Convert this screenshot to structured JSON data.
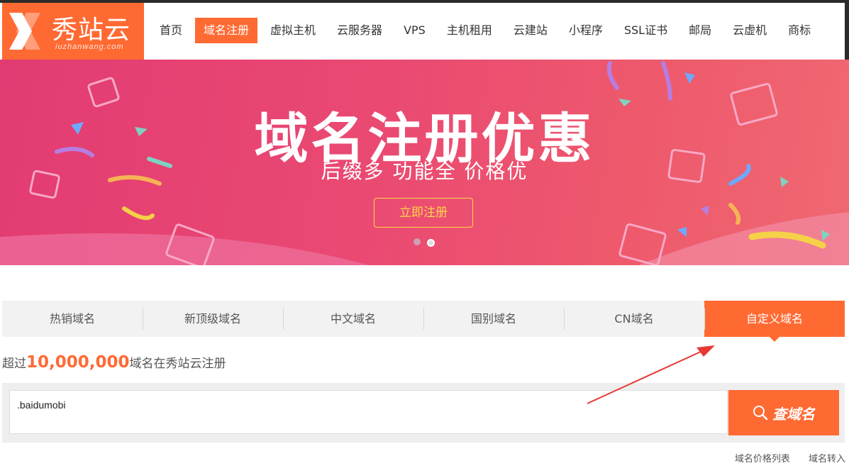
{
  "header": {
    "logo_name": "秀站云",
    "logo_sub": "iuzhanwang.com",
    "nav": [
      {
        "label": "首页",
        "active": false
      },
      {
        "label": "域名注册",
        "active": true
      },
      {
        "label": "虚拟主机",
        "active": false
      },
      {
        "label": "云服务器",
        "active": false
      },
      {
        "label": "VPS",
        "active": false
      },
      {
        "label": "主机租用",
        "active": false
      },
      {
        "label": "云建站",
        "active": false
      },
      {
        "label": "小程序",
        "active": false
      },
      {
        "label": "SSL证书",
        "active": false
      },
      {
        "label": "邮局",
        "active": false
      },
      {
        "label": "云虚机",
        "active": false
      },
      {
        "label": "商标",
        "active": false
      }
    ]
  },
  "banner": {
    "title": "域名注册优惠",
    "subtitle": "后缀多  功能全  价格优",
    "button": "立即注册",
    "slides": 2,
    "current_slide": 2
  },
  "tabs": [
    {
      "label": "热销域名",
      "active": false
    },
    {
      "label": "新顶级域名",
      "active": false
    },
    {
      "label": "中文域名",
      "active": false
    },
    {
      "label": "国别域名",
      "active": false
    },
    {
      "label": "CN域名",
      "active": false
    },
    {
      "label": "自定义域名",
      "active": true
    }
  ],
  "stats": {
    "prefix": "超过",
    "number": "10,000,000",
    "suffix": "域名在秀站云注册"
  },
  "search": {
    "value": ".baidumobi",
    "button": "查域名"
  },
  "footer_links": [
    "域名价格列表",
    "域名转入"
  ],
  "colors": {
    "accent": "#ff6a33",
    "banner": "#e84a72",
    "button_outline": "#ffd54a",
    "annotation_arrow": "#e53935"
  }
}
